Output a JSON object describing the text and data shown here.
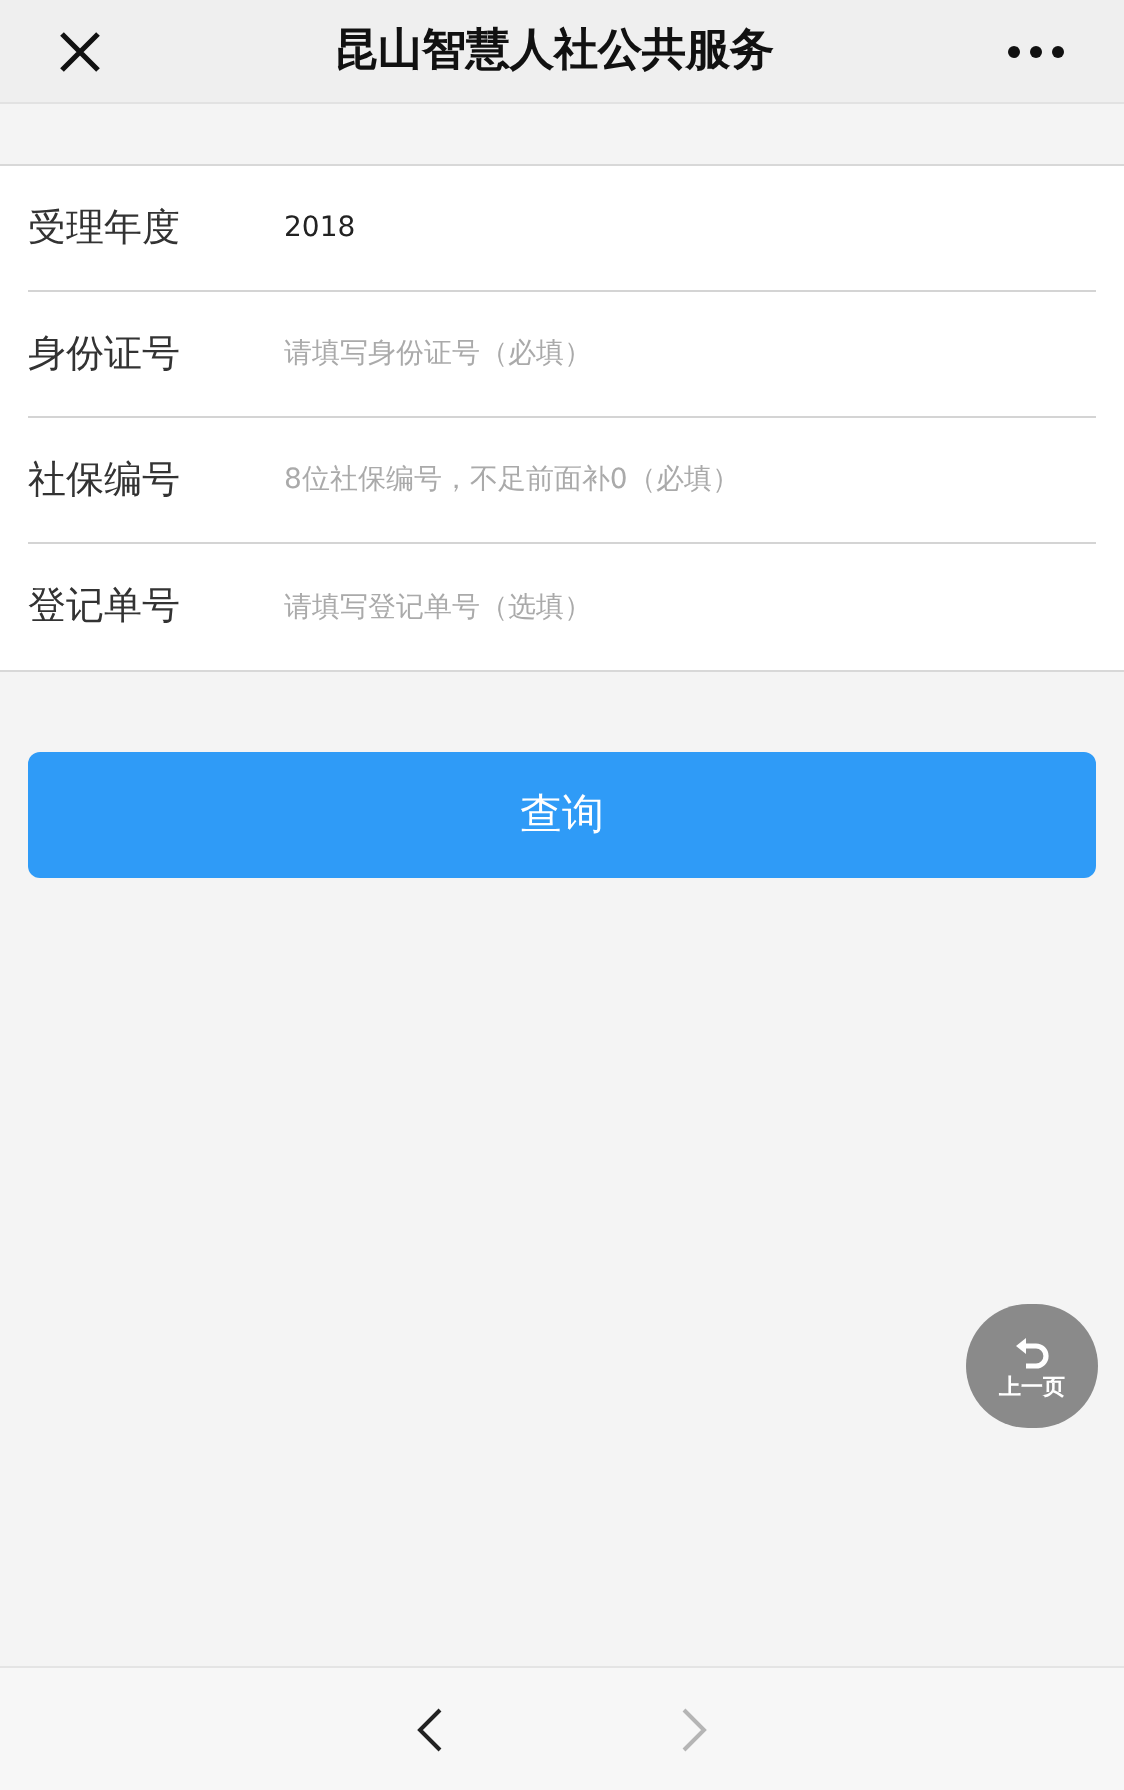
{
  "header": {
    "title": "昆山智慧人社公共服务"
  },
  "form": {
    "fields": [
      {
        "label": "受理年度",
        "value": "2018"
      },
      {
        "label": "身份证号",
        "placeholder": "请填写身份证号（必填）"
      },
      {
        "label": "社保编号",
        "placeholder": "8位社保编号，不足前面补0（必填）"
      },
      {
        "label": "登记单号",
        "placeholder": "请填写登记单号（选填）"
      }
    ]
  },
  "submit_button": "查询",
  "floating_button": {
    "label": "上一页"
  },
  "bottom_nav": {
    "back": {
      "disabled": false
    },
    "forward": {
      "disabled": true
    }
  }
}
